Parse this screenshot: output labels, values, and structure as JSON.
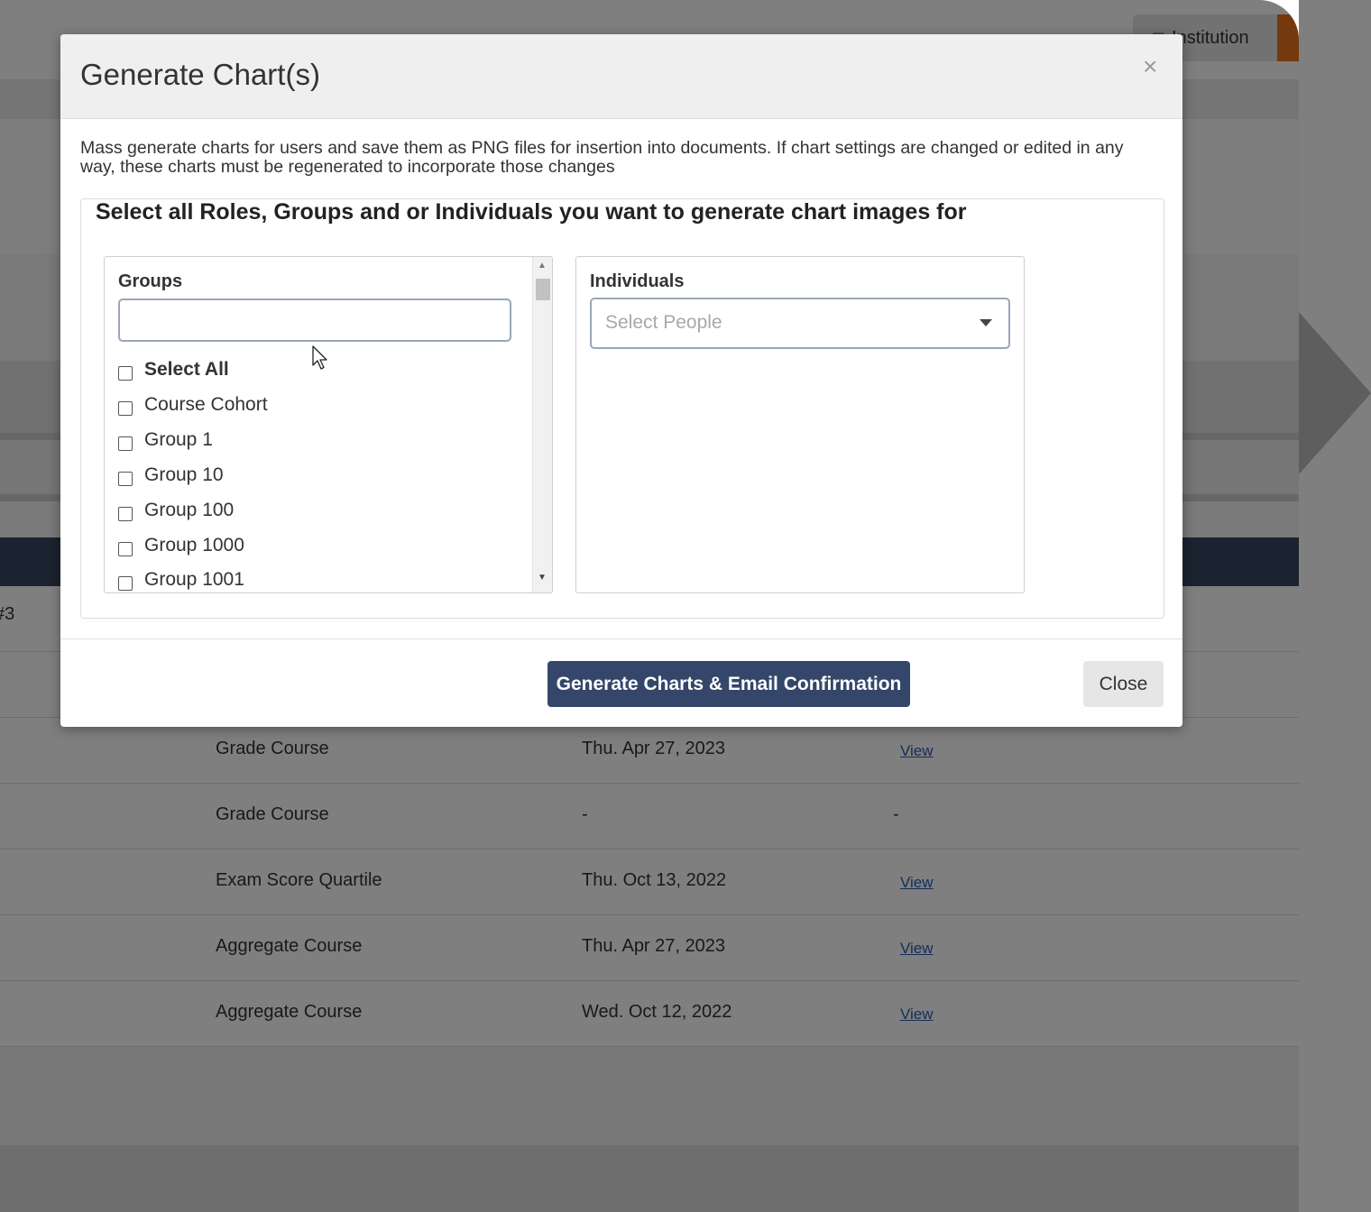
{
  "background": {
    "top_button": {
      "icon": "briefcase-icon",
      "label": "Institution"
    },
    "row0_prefix": "#3",
    "table_rows": [
      {
        "type": "Grade Course",
        "date": "Thu. Apr 27, 2023",
        "action": "View"
      },
      {
        "type": "Grade Course",
        "date": "-",
        "action": "-"
      },
      {
        "type": "Exam Score Quartile",
        "date": "Thu. Oct 13, 2022",
        "action": "View"
      },
      {
        "type": "Aggregate Course",
        "date": "Thu. Apr 27, 2023",
        "action": "View"
      },
      {
        "type": "Aggregate Course",
        "date": "Wed. Oct 12, 2022",
        "action": "View"
      }
    ]
  },
  "modal": {
    "title": "Generate Chart(s)",
    "close_icon": "×",
    "description": "Mass generate charts for users and save them as PNG files for insertion into documents. If chart settings are changed or edited in any way, these charts must be regenerated to incorporate those changes",
    "panel_heading": "Select all Roles, Groups and or Individuals you want to generate chart images for",
    "groups": {
      "label": "Groups",
      "search_value": "",
      "items": [
        "Select All",
        "Course Cohort",
        "Group 1",
        "Group 10",
        "Group 100",
        "Group 1000",
        "Group 1001"
      ]
    },
    "individuals": {
      "label": "Individuals",
      "placeholder": "Select People"
    },
    "buttons": {
      "generate": "Generate Charts & Email Confirmation",
      "close": "Close"
    }
  },
  "colors": {
    "primary_button": "#34476a",
    "accent": "#e8731a",
    "table_header": "#35475f",
    "link": "#2a5db0"
  }
}
